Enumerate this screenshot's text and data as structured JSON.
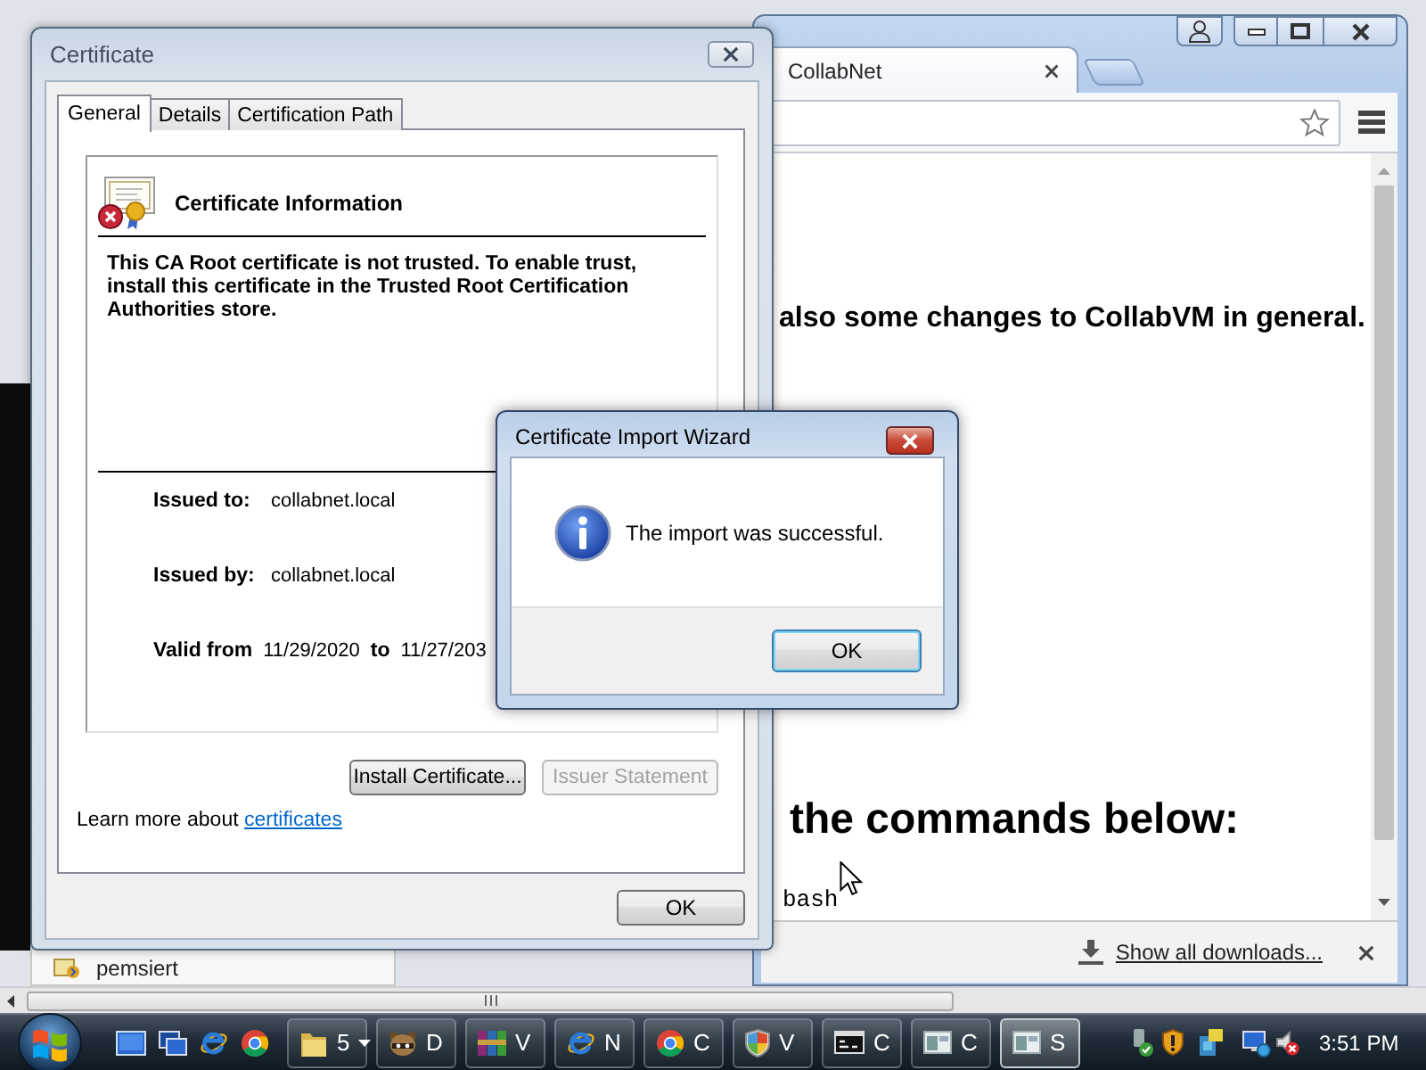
{
  "background_window": {
    "file_item": {
      "name": "pemsiert"
    }
  },
  "browser": {
    "tab": {
      "title": "CollabNet"
    },
    "page": {
      "lines": [
        {
          "kind": "heading",
          "text": "also some changes to CollabVM in general."
        },
        {
          "kind": "heading_large",
          "text": "the commands below:"
        },
        {
          "kind": "code",
          "text": "bash"
        }
      ]
    },
    "download_shelf": {
      "link": "Show all downloads..."
    }
  },
  "certificate_dialog": {
    "title": "Certificate",
    "tabs": [
      {
        "label": "General",
        "selected": true
      },
      {
        "label": "Details",
        "selected": false
      },
      {
        "label": "Certification Path",
        "selected": false
      }
    ],
    "info_title": "Certificate Information",
    "message": "This CA Root certificate is not trusted. To enable trust, install this certificate in the Trusted Root Certification Authorities store.",
    "fields": [
      {
        "label": "Issued to:",
        "value": "collabnet.local"
      },
      {
        "label": "Issued by:",
        "value": "collabnet.local"
      }
    ],
    "validity": {
      "label": "Valid from",
      "from": "11/29/2020",
      "separator": "to",
      "to": "11/27/203"
    },
    "buttons": [
      {
        "label": "Install Certificate...",
        "disabled": false
      },
      {
        "label": "Issuer Statement",
        "disabled": true
      }
    ],
    "learn_more": {
      "text": "Learn more about",
      "link": "certificates"
    },
    "ok_button": "OK"
  },
  "wizard": {
    "title": "Certificate Import Wizard",
    "message": "The import was successful.",
    "ok_button": {
      "label": "OK",
      "focused": true
    }
  },
  "taskbar": {
    "tasks": [
      {
        "kind": "folder",
        "label": "5",
        "grouped": true,
        "selected": false
      },
      {
        "kind": "animal",
        "label": "D",
        "grouped": false,
        "selected": false
      },
      {
        "kind": "archive",
        "label": "V",
        "grouped": false,
        "selected": false
      },
      {
        "kind": "browser_e",
        "label": "N",
        "grouped": false,
        "selected": false
      },
      {
        "kind": "browser_round",
        "label": "C",
        "grouped": false,
        "selected": false
      },
      {
        "kind": "shield",
        "label": "V",
        "grouped": false,
        "selected": false
      },
      {
        "kind": "terminal",
        "label": "C",
        "grouped": false,
        "selected": false
      },
      {
        "kind": "window",
        "label": "C",
        "grouped": false,
        "selected": false
      },
      {
        "kind": "window",
        "label": "S",
        "grouped": false,
        "selected": true
      }
    ],
    "clock": "3:51 PM"
  }
}
